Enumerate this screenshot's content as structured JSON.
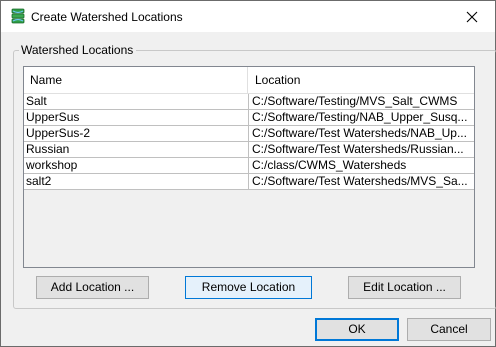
{
  "window": {
    "title": "Create Watershed Locations",
    "app_icon": "watershed-app-icon",
    "close_icon": "close-icon"
  },
  "group": {
    "label": "Watershed Locations"
  },
  "table": {
    "columns": [
      "Name",
      "Location"
    ],
    "rows": [
      {
        "name": "Salt",
        "location": "C:/Software/Testing/MVS_Salt_CWMS"
      },
      {
        "name": "UpperSus",
        "location": "C:/Software/Testing/NAB_Upper_Susq..."
      },
      {
        "name": "UpperSus-2",
        "location": "C:/Software/Test Watersheds/NAB_Up..."
      },
      {
        "name": "Russian",
        "location": "C:/Software/Test Watersheds/Russian..."
      },
      {
        "name": "workshop",
        "location": "C:/class/CWMS_Watersheds"
      },
      {
        "name": "salt2",
        "location": "C:/Software/Test Watersheds/MVS_Sa..."
      }
    ]
  },
  "buttons": {
    "add": "Add Location ...",
    "remove": "Remove Location",
    "edit": "Edit Location ...",
    "ok": "OK",
    "cancel": "Cancel"
  }
}
